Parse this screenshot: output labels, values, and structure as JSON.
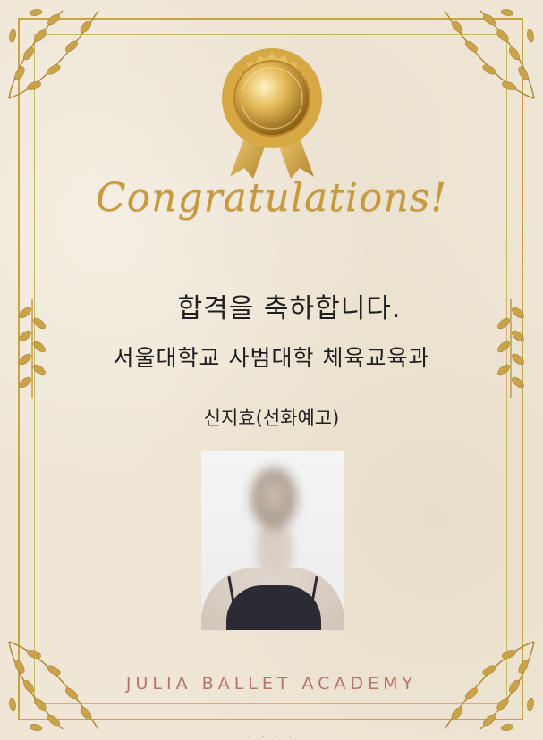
{
  "certificate": {
    "heading": "Congratulations!",
    "line1": "합격을 축하합니다.",
    "line2": "서울대학교 사범대학 체육교육과",
    "line3": "신지효(선화예고)",
    "footer": "JULIA BALLET ACADEMY",
    "carousel_dots": "• • • •"
  },
  "colors": {
    "gold": "#c79a3c",
    "paper": "#efe6d5",
    "footer": "#b5756a"
  },
  "icons": {
    "medal": "gold-medal-ribbon-icon",
    "corner": "gold-leaf-corner-icon"
  }
}
